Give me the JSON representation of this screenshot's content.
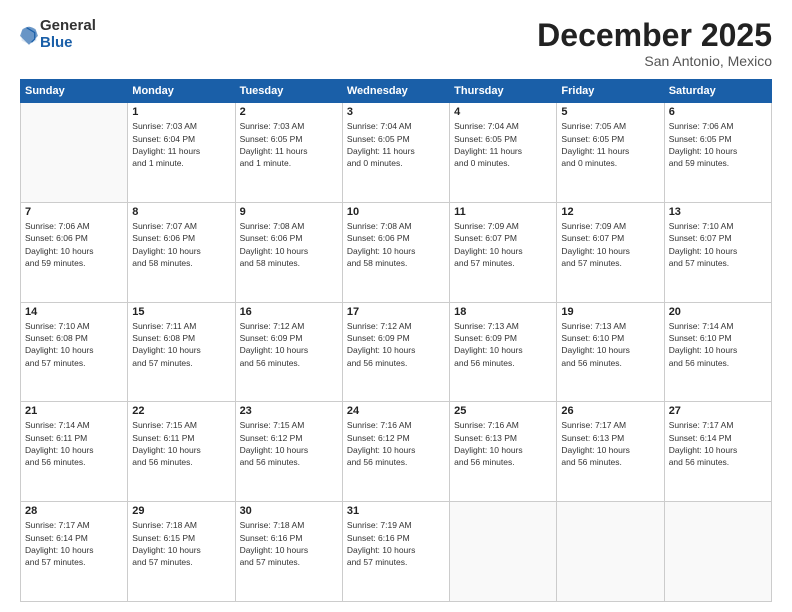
{
  "header": {
    "logo_general": "General",
    "logo_blue": "Blue",
    "month_title": "December 2025",
    "location": "San Antonio, Mexico"
  },
  "days_of_week": [
    "Sunday",
    "Monday",
    "Tuesday",
    "Wednesday",
    "Thursday",
    "Friday",
    "Saturday"
  ],
  "weeks": [
    [
      {
        "day": "",
        "info": ""
      },
      {
        "day": "1",
        "info": "Sunrise: 7:03 AM\nSunset: 6:04 PM\nDaylight: 11 hours\nand 1 minute."
      },
      {
        "day": "2",
        "info": "Sunrise: 7:03 AM\nSunset: 6:05 PM\nDaylight: 11 hours\nand 1 minute."
      },
      {
        "day": "3",
        "info": "Sunrise: 7:04 AM\nSunset: 6:05 PM\nDaylight: 11 hours\nand 0 minutes."
      },
      {
        "day": "4",
        "info": "Sunrise: 7:04 AM\nSunset: 6:05 PM\nDaylight: 11 hours\nand 0 minutes."
      },
      {
        "day": "5",
        "info": "Sunrise: 7:05 AM\nSunset: 6:05 PM\nDaylight: 11 hours\nand 0 minutes."
      },
      {
        "day": "6",
        "info": "Sunrise: 7:06 AM\nSunset: 6:05 PM\nDaylight: 10 hours\nand 59 minutes."
      }
    ],
    [
      {
        "day": "7",
        "info": "Sunrise: 7:06 AM\nSunset: 6:06 PM\nDaylight: 10 hours\nand 59 minutes."
      },
      {
        "day": "8",
        "info": "Sunrise: 7:07 AM\nSunset: 6:06 PM\nDaylight: 10 hours\nand 58 minutes."
      },
      {
        "day": "9",
        "info": "Sunrise: 7:08 AM\nSunset: 6:06 PM\nDaylight: 10 hours\nand 58 minutes."
      },
      {
        "day": "10",
        "info": "Sunrise: 7:08 AM\nSunset: 6:06 PM\nDaylight: 10 hours\nand 58 minutes."
      },
      {
        "day": "11",
        "info": "Sunrise: 7:09 AM\nSunset: 6:07 PM\nDaylight: 10 hours\nand 57 minutes."
      },
      {
        "day": "12",
        "info": "Sunrise: 7:09 AM\nSunset: 6:07 PM\nDaylight: 10 hours\nand 57 minutes."
      },
      {
        "day": "13",
        "info": "Sunrise: 7:10 AM\nSunset: 6:07 PM\nDaylight: 10 hours\nand 57 minutes."
      }
    ],
    [
      {
        "day": "14",
        "info": "Sunrise: 7:10 AM\nSunset: 6:08 PM\nDaylight: 10 hours\nand 57 minutes."
      },
      {
        "day": "15",
        "info": "Sunrise: 7:11 AM\nSunset: 6:08 PM\nDaylight: 10 hours\nand 57 minutes."
      },
      {
        "day": "16",
        "info": "Sunrise: 7:12 AM\nSunset: 6:09 PM\nDaylight: 10 hours\nand 56 minutes."
      },
      {
        "day": "17",
        "info": "Sunrise: 7:12 AM\nSunset: 6:09 PM\nDaylight: 10 hours\nand 56 minutes."
      },
      {
        "day": "18",
        "info": "Sunrise: 7:13 AM\nSunset: 6:09 PM\nDaylight: 10 hours\nand 56 minutes."
      },
      {
        "day": "19",
        "info": "Sunrise: 7:13 AM\nSunset: 6:10 PM\nDaylight: 10 hours\nand 56 minutes."
      },
      {
        "day": "20",
        "info": "Sunrise: 7:14 AM\nSunset: 6:10 PM\nDaylight: 10 hours\nand 56 minutes."
      }
    ],
    [
      {
        "day": "21",
        "info": "Sunrise: 7:14 AM\nSunset: 6:11 PM\nDaylight: 10 hours\nand 56 minutes."
      },
      {
        "day": "22",
        "info": "Sunrise: 7:15 AM\nSunset: 6:11 PM\nDaylight: 10 hours\nand 56 minutes."
      },
      {
        "day": "23",
        "info": "Sunrise: 7:15 AM\nSunset: 6:12 PM\nDaylight: 10 hours\nand 56 minutes."
      },
      {
        "day": "24",
        "info": "Sunrise: 7:16 AM\nSunset: 6:12 PM\nDaylight: 10 hours\nand 56 minutes."
      },
      {
        "day": "25",
        "info": "Sunrise: 7:16 AM\nSunset: 6:13 PM\nDaylight: 10 hours\nand 56 minutes."
      },
      {
        "day": "26",
        "info": "Sunrise: 7:17 AM\nSunset: 6:13 PM\nDaylight: 10 hours\nand 56 minutes."
      },
      {
        "day": "27",
        "info": "Sunrise: 7:17 AM\nSunset: 6:14 PM\nDaylight: 10 hours\nand 56 minutes."
      }
    ],
    [
      {
        "day": "28",
        "info": "Sunrise: 7:17 AM\nSunset: 6:14 PM\nDaylight: 10 hours\nand 57 minutes."
      },
      {
        "day": "29",
        "info": "Sunrise: 7:18 AM\nSunset: 6:15 PM\nDaylight: 10 hours\nand 57 minutes."
      },
      {
        "day": "30",
        "info": "Sunrise: 7:18 AM\nSunset: 6:16 PM\nDaylight: 10 hours\nand 57 minutes."
      },
      {
        "day": "31",
        "info": "Sunrise: 7:19 AM\nSunset: 6:16 PM\nDaylight: 10 hours\nand 57 minutes."
      },
      {
        "day": "",
        "info": ""
      },
      {
        "day": "",
        "info": ""
      },
      {
        "day": "",
        "info": ""
      }
    ]
  ]
}
